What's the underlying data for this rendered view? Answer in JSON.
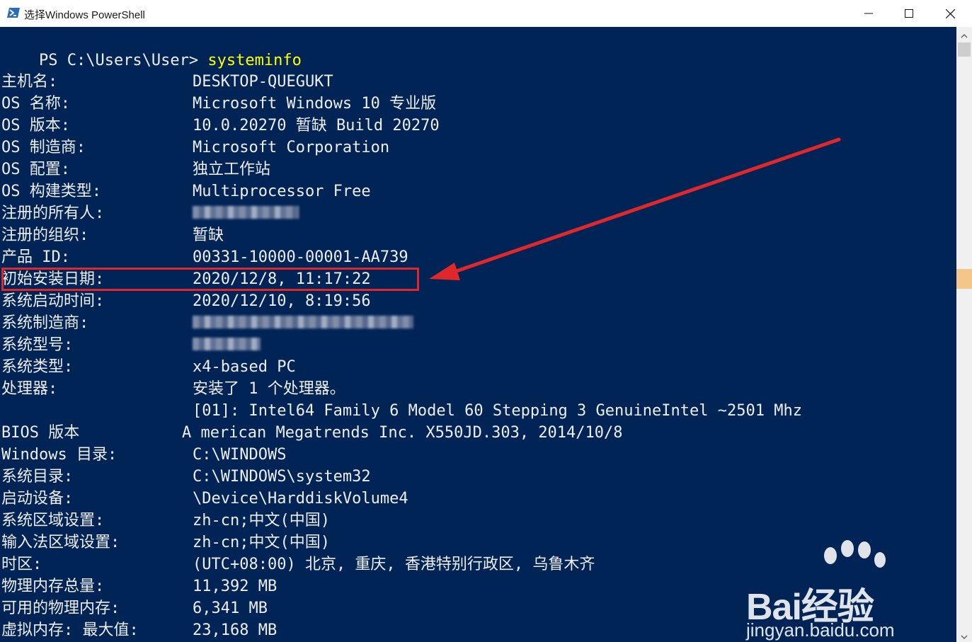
{
  "window": {
    "title": "选择Windows PowerShell",
    "icon": "powershell-icon",
    "controls": [
      "minimize-icon",
      "maximize-icon",
      "close-icon"
    ]
  },
  "console": {
    "prompt": "PS C:\\Users\\User> ",
    "command": "systeminfo",
    "rows": [
      {
        "label": "主机名:",
        "value": "DESKTOP-QUEGUKT"
      },
      {
        "label": "OS 名称:",
        "value": "Microsoft Windows 10 专业版"
      },
      {
        "label": "OS 版本:",
        "value": "10.0.20270 暂缺 Build 20270"
      },
      {
        "label": "OS 制造商:",
        "value": "Microsoft Corporation"
      },
      {
        "label": "OS 配置:",
        "value": "独立工作站"
      },
      {
        "label": "OS 构建类型:",
        "value": "Multiprocessor Free"
      },
      {
        "label": "注册的所有人:",
        "value": ""
      },
      {
        "label": "注册的组织:",
        "value": "暂缺"
      },
      {
        "label": "产品 ID:",
        "value": "00331-10000-00001-AA739"
      },
      {
        "label": "初始安装日期:",
        "value": "2020/12/8, 11:17:22"
      },
      {
        "label": "系统启动时间:",
        "value": "2020/12/10, 8:19:56"
      },
      {
        "label": "系统制造商:",
        "value": ""
      },
      {
        "label": "系统型号:",
        "value": ""
      },
      {
        "label": "系统类型:",
        "value": "x4-based PC"
      },
      {
        "label": "处理器:",
        "value": "安装了 1 个处理器。"
      },
      {
        "label": "",
        "value": "[01]: Intel64 Family 6 Model 60 Stepping 3 GenuineIntel ~2501 Mhz"
      },
      {
        "label": "BIOS 版本",
        "value": "A merican Megatrends Inc. X550JD.303, 2014/10/8"
      },
      {
        "label": "Windows 目录:",
        "value": "C:\\WINDOWS"
      },
      {
        "label": "系统目录:",
        "value": "C:\\WINDOWS\\system32"
      },
      {
        "label": "启动设备:",
        "value": "\\Device\\HarddiskVolume4"
      },
      {
        "label": "系统区域设置:",
        "value": "zh-cn;中文(中国)"
      },
      {
        "label": "输入法区域设置:",
        "value": "zh-cn;中文(中国)"
      },
      {
        "label": "时区:",
        "value": "(UTC+08:00) 北京, 重庆, 香港特别行政区, 乌鲁木齐"
      },
      {
        "label": "物理内存总量:",
        "value": "11,392 MB"
      },
      {
        "label": "可用的物理内存:",
        "value": "6,341 MB"
      },
      {
        "label": "虚拟内存: 最大值:",
        "value": "23,168 MB"
      }
    ]
  },
  "annotation": {
    "highlight_color": "#e0282b"
  },
  "watermark": {
    "brand": "Bai经验",
    "url": "jingyan.baidu.com"
  },
  "colors": {
    "console_bg": "#012456",
    "console_fg": "#eeedf0",
    "command_fg": "#ffff00"
  }
}
